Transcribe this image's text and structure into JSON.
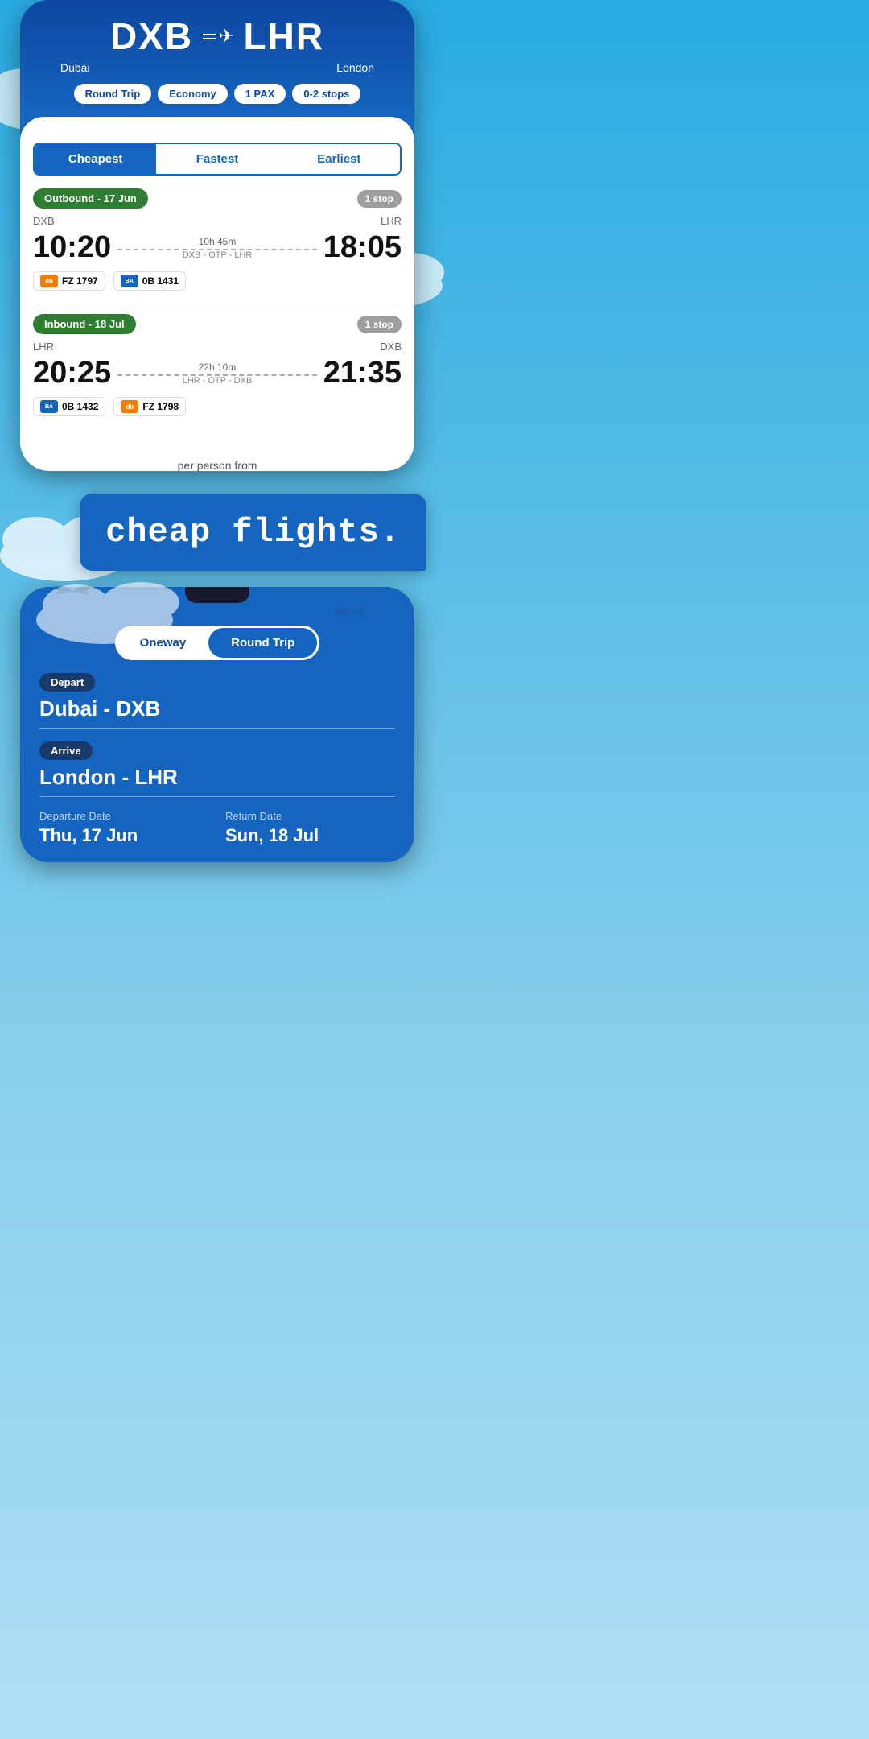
{
  "app": {
    "tagline": "cheap flights."
  },
  "phone_top": {
    "origin_code": "DXB",
    "origin_name": "Dubai",
    "destination_code": "LHR",
    "destination_name": "London",
    "filters": {
      "trip_type": "Round Trip",
      "cabin": "Economy",
      "pax": "1 PAX",
      "stops": "0-2 stops"
    },
    "tabs": {
      "cheapest": "Cheapest",
      "fastest": "Fastest",
      "earliest": "Earliest"
    },
    "outbound": {
      "label": "Outbound - 17 Jun",
      "stops": "1 stop",
      "origin": "DXB",
      "destination": "LHR",
      "depart_time": "10:20",
      "arrive_time": "18:05",
      "duration": "10h 45m",
      "via": "DXB - OTP - LHR",
      "airlines": [
        {
          "code": "FZ 1797",
          "logo_type": "dubai",
          "logo_text": "dubai"
        },
        {
          "code": "0B 1431",
          "logo_type": "blue",
          "logo_text": "blue"
        }
      ]
    },
    "inbound": {
      "label": "Inbound - 18 Jul",
      "stops": "1 stop",
      "origin": "LHR",
      "destination": "DXB",
      "depart_time": "20:25",
      "arrive_time": "21:35",
      "duration": "22h 10m",
      "via": "LHR - OTP - DXB",
      "airlines": [
        {
          "code": "0B 1432",
          "logo_type": "blue",
          "logo_text": "blue"
        },
        {
          "code": "FZ 1798",
          "logo_type": "dubai",
          "logo_text": "dubai"
        }
      ]
    }
  },
  "phone_bottom": {
    "toggle": {
      "oneway": "Oneway",
      "roundtrip": "Round Trip"
    },
    "depart_label": "Depart",
    "depart_value": "Dubai - DXB",
    "arrive_label": "Arrive",
    "arrive_value": "London - LHR",
    "departure_date_label": "Departure Date",
    "departure_date_value": "Thu, 17 Jun",
    "return_date_label": "Return Date",
    "return_date_value": "Sun, 18 Jul"
  }
}
